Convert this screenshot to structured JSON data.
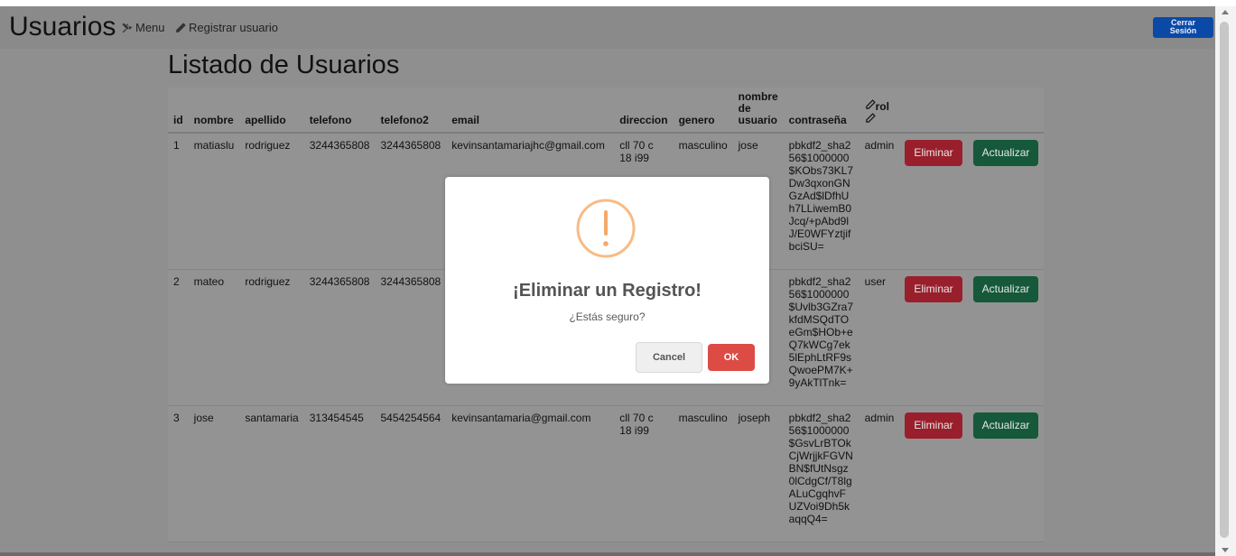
{
  "navbar": {
    "brand": "Usuarios",
    "menu_label": "Menu",
    "register_label": "Registrar usuario",
    "logout_line1": "Cerrar",
    "logout_line2": "Sesión"
  },
  "page": {
    "title": "Listado de Usuarios"
  },
  "table": {
    "headers": {
      "id": "id",
      "nombre": "nombre",
      "apellido": "apellido",
      "telefono": "telefono",
      "telefono2": "telefono2",
      "email": "email",
      "direccion": "direccion",
      "genero": "genero",
      "usuario_line1": "nombre",
      "usuario_line2": "de",
      "usuario_line3": "usuario",
      "contrasena": "contraseña",
      "rol": "rol"
    },
    "rows": [
      {
        "id": "1",
        "nombre": "matiaslu",
        "apellido": "rodriguez",
        "telefono": "3244365808",
        "telefono2": "3244365808",
        "email": "kevinsantamariajhc@gmail.com",
        "direccion_line1": "cll 70 c",
        "direccion_line2": "18 i99",
        "genero": "masculino",
        "usuario": "jose",
        "contrasena": "pbkdf2_sha256$1000000$KObs73KL7Dw3qxonGNGzAd$lDfhUh7LLiwemB0Jcq/+pAbd9lJ/E0WFYztjifbciSU=",
        "rol": "admin"
      },
      {
        "id": "2",
        "nombre": "mateo",
        "apellido": "rodriguez",
        "telefono": "3244365808",
        "telefono2": "3244365808",
        "email": "",
        "direccion_line1": "",
        "direccion_line2": "",
        "genero": "",
        "usuario": "",
        "contrasena": "pbkdf2_sha256$1000000$Uvlb3GZra7kfdMSQdTOeGm$HOb+eQ7kWCg7ek5lEphLtRF9sQwoePM7K+9yAkTlTnk=",
        "rol": "user"
      },
      {
        "id": "3",
        "nombre": "jose",
        "apellido": "santamaria",
        "telefono": "313454545",
        "telefono2": "5454254564",
        "email": "kevinsantamaria@gmail.com",
        "direccion_line1": "cll 70 c",
        "direccion_line2": "18 i99",
        "genero": "masculino",
        "usuario": "joseph",
        "contrasena": "pbkdf2_sha256$1000000$GsvLrBTOkCjWrjjkFGVNBN$fUtNsgz0lCdgCf/T8lgALuCgqhvFUZVoi9Dh5kaqqQ4=",
        "rol": "admin"
      }
    ],
    "delete_label": "Eliminar",
    "update_label": "Actualizar"
  },
  "modal": {
    "title": "¡Eliminar un Registro!",
    "text": "¿Estás seguro?",
    "cancel_label": "Cancel",
    "ok_label": "OK",
    "icon_color": "#f8bb86",
    "ok_color": "#dd4b45"
  },
  "icons": {
    "menu": "tools-icon",
    "register": "pencil-icon",
    "rol": "pencil-icon",
    "modal": "warning-icon"
  }
}
